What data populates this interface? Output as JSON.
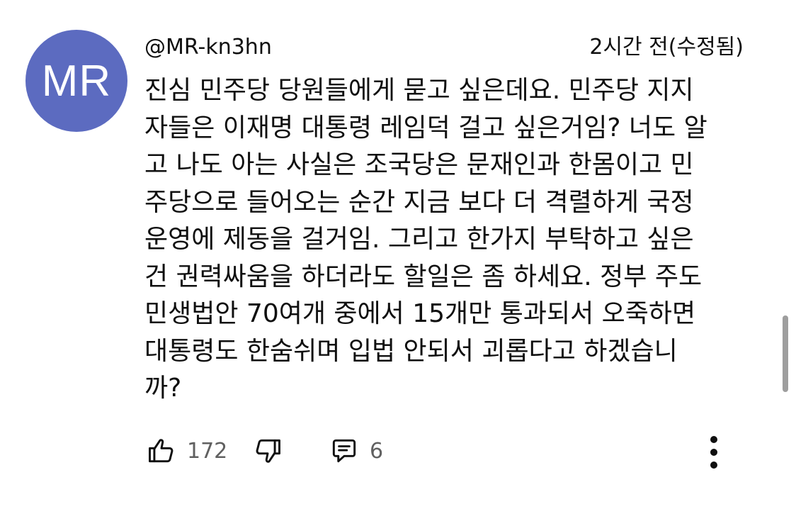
{
  "comment": {
    "avatar_initials": "MR",
    "avatar_color": "#5c6bc0",
    "author": "@MR-kn3hn",
    "time": "2시간 전(수정됨)",
    "body_lines": [
      "진심 민주당 당원들에게 묻고 싶은데요. 민주당 지지",
      "자들은 이재명 대통령 레임덕 걸고 싶은거임? 너도 알",
      "고 나도 아는 사실은 조국당은 문재인과 한몸이고 민",
      "주당으로 들어오는 순간 지금 보다 더 격렬하게 국정",
      "운영에 제동을 걸거임. 그리고 한가지 부탁하고 싶은",
      "건 권력싸움을 하더라도 할일은 좀 하세요. 정부 주도",
      "민생법안 70여개 중에서 15개만 통과되서 오죽하면",
      "대통령도 한숨쉬며 입법 안되서 괴롭다고 하겠습니",
      "까?"
    ],
    "like_count": "172",
    "reply_count": "6"
  },
  "icons": {
    "like": "thumbs-up-icon",
    "dislike": "thumbs-down-icon",
    "reply": "comment-icon",
    "more": "more-vertical-icon"
  }
}
